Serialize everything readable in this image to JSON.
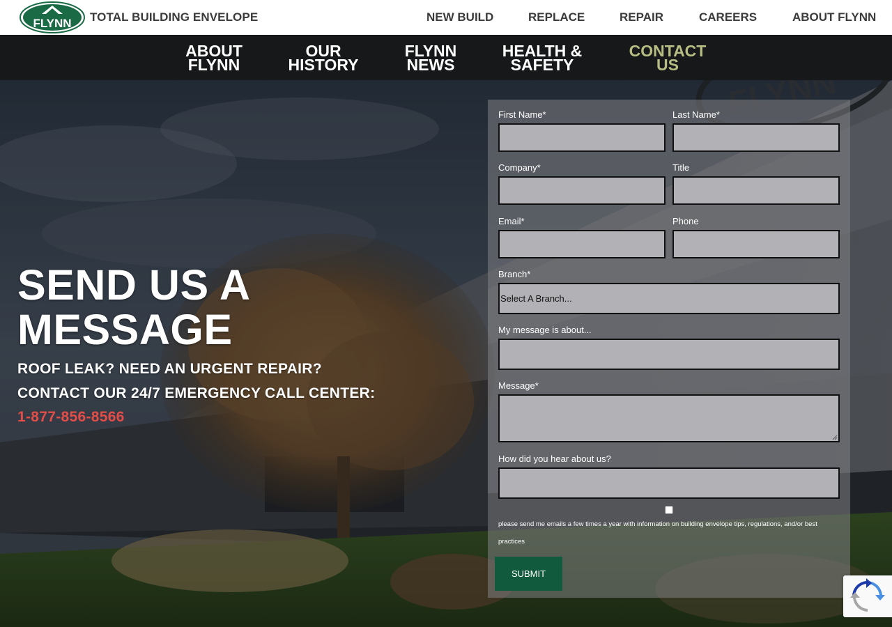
{
  "header": {
    "logo_text": "FLYNN",
    "tagline": "TOTAL BUILDING ENVELOPE",
    "nav": [
      {
        "label": "NEW BUILD"
      },
      {
        "label": "REPLACE"
      },
      {
        "label": "REPAIR"
      },
      {
        "label": "CAREERS"
      },
      {
        "label": "ABOUT FLYNN"
      }
    ]
  },
  "subnav": {
    "items": [
      {
        "line1": "ABOUT",
        "line2": "FLYNN",
        "active": false
      },
      {
        "line1": "OUR",
        "line2": "HISTORY",
        "active": false
      },
      {
        "line1": "FLYNN",
        "line2": "NEWS",
        "active": false
      },
      {
        "line1": "HEALTH &",
        "line2": "SAFETY",
        "active": false
      },
      {
        "line1": "CONTACT",
        "line2": "US",
        "active": true
      }
    ],
    "active_color": "#b7bd83"
  },
  "hero": {
    "title_line1": "SEND US A",
    "title_line2": "MESSAGE",
    "line1": "ROOF LEAK? NEED AN URGENT REPAIR?",
    "line2": "CONTACT OUR 24/7 EMERGENCY CALL CENTER:",
    "phone": "1-877-856-8566",
    "phone_color": "#e24d47",
    "building_sign_text": "FLYNN"
  },
  "form": {
    "first_name": {
      "label": "First Name*",
      "value": ""
    },
    "last_name": {
      "label": "Last Name*",
      "value": ""
    },
    "company": {
      "label": "Company*",
      "value": ""
    },
    "title": {
      "label": "Title",
      "value": ""
    },
    "email": {
      "label": "Email*",
      "value": ""
    },
    "phone": {
      "label": "Phone",
      "value": ""
    },
    "branch": {
      "label": "Branch*",
      "selected": "Select A Branch..."
    },
    "about": {
      "label": "My message is about...",
      "value": ""
    },
    "message": {
      "label": "Message*",
      "value": ""
    },
    "heard": {
      "label": "How did you hear about us?",
      "value": ""
    },
    "consent_checked": false,
    "consent_text": "please send me emails a few times a year with information on building envelope tips, regulations, and/or best practices",
    "submit_label": "SUBMIT",
    "submit_color": "#115a3d"
  },
  "colors": {
    "brand_green": "#1a6b45",
    "header_bg": "#ffffff",
    "subnav_bg": "#16181a"
  }
}
